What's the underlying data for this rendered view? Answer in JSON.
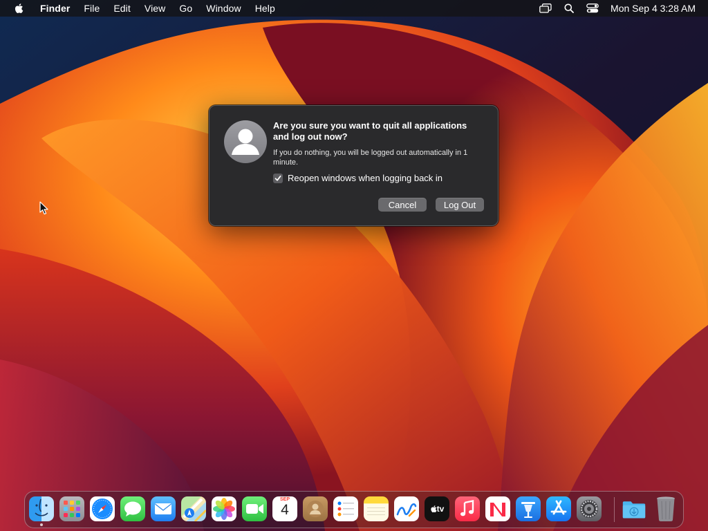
{
  "menubar": {
    "app_name": "Finder",
    "items": [
      "File",
      "Edit",
      "View",
      "Go",
      "Window",
      "Help"
    ],
    "clock": "Mon Sep 4  3:28 AM",
    "status_icons": [
      "screen-mirroring-icon",
      "spotlight-search-icon",
      "control-center-icon"
    ]
  },
  "dialog": {
    "title": "Are you sure you want to quit all applications and log out now?",
    "message": "If you do nothing, you will be logged out automatically in 1 minute.",
    "checkbox_label": "Reopen windows when logging back in",
    "checkbox_checked": true,
    "cancel_label": "Cancel",
    "logout_label": "Log Out"
  },
  "dock": {
    "apps": [
      {
        "name": "Finder",
        "icon": "finder-icon",
        "running": true
      },
      {
        "name": "Launchpad",
        "icon": "launchpad-icon"
      },
      {
        "name": "Safari",
        "icon": "safari-icon"
      },
      {
        "name": "Messages",
        "icon": "messages-icon"
      },
      {
        "name": "Mail",
        "icon": "mail-icon"
      },
      {
        "name": "Maps",
        "icon": "maps-icon"
      },
      {
        "name": "Photos",
        "icon": "photos-icon"
      },
      {
        "name": "FaceTime",
        "icon": "facetime-icon"
      },
      {
        "name": "Calendar",
        "icon": "calendar-icon"
      },
      {
        "name": "Contacts",
        "icon": "contacts-icon"
      },
      {
        "name": "Reminders",
        "icon": "reminders-icon"
      },
      {
        "name": "Notes",
        "icon": "notes-icon"
      },
      {
        "name": "Freeform",
        "icon": "freeform-icon"
      },
      {
        "name": "TV",
        "icon": "apple-tv-icon"
      },
      {
        "name": "Music",
        "icon": "music-icon"
      },
      {
        "name": "News",
        "icon": "news-icon"
      },
      {
        "name": "Keynote",
        "icon": "keynote-icon"
      },
      {
        "name": "App Store",
        "icon": "app-store-icon"
      },
      {
        "name": "System Settings",
        "icon": "system-settings-icon"
      },
      {
        "name": "Downloads",
        "icon": "downloads-folder-icon"
      },
      {
        "name": "Trash",
        "icon": "trash-icon"
      }
    ],
    "calendar_month": "SEP",
    "calendar_day": "4",
    "tv_label": "tv"
  },
  "colors": {
    "menubar_bg": "#141416",
    "dialog_bg": "#2a2a2c",
    "button_bg": "#6a6a6d",
    "wallpaper_orange": "#f0761a",
    "wallpaper_deep": "#7a1020"
  }
}
